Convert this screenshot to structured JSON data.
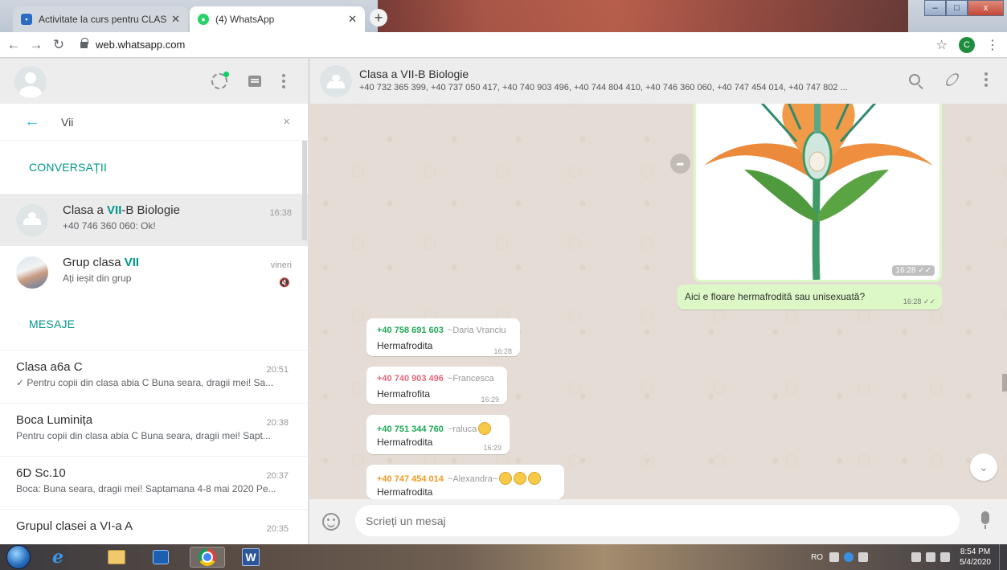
{
  "browser": {
    "tabs": [
      {
        "title": "Activitate la curs pentru CLASA a",
        "close": "✕"
      },
      {
        "title": "(4) WhatsApp",
        "close": "✕"
      }
    ],
    "new_tab": "+",
    "url": "web.whatsapp.com",
    "profile_initial": "C",
    "window_controls": {
      "minimize": "–",
      "maximize": "□",
      "close": "x"
    }
  },
  "sidebar": {
    "search_query": "Vii",
    "clear_icon": "×",
    "sections": {
      "conversations": "CONVERSAȚII",
      "messages": "MESAJE"
    },
    "conversations": [
      {
        "title_pre": "Clasa a ",
        "title_match": "VII",
        "title_post": "-B Biologie",
        "subtitle": "+40 746 360 060: Ok!",
        "time": "16:38",
        "active": true,
        "avatar": "group-avatar"
      },
      {
        "title_pre": "Grup clasa ",
        "title_match": "VII",
        "title_post": "",
        "subtitle": "Ați ieșit din grup",
        "time": "vineri",
        "muted": true,
        "avatar": "photo-avatar"
      }
    ],
    "messages": [
      {
        "title": "Clasa a6a C",
        "time": "20:51",
        "subtitle": "✓ Pentru copii din clasa abia C Buna seara, dragii mei! Sa..."
      },
      {
        "title": "Boca Luminița",
        "time": "20:38",
        "subtitle": "Pentru copii din clasa abia C Buna seara, dragii mei! Sapt..."
      },
      {
        "title": "6D Sc.10",
        "time": "20:37",
        "subtitle": "Boca: Buna seara, dragii mei! Saptamana 4-8 mai 2020 Pe..."
      },
      {
        "title": "Grupul clasei a VI-a A",
        "time": "20:35",
        "subtitle": ""
      }
    ]
  },
  "conversation": {
    "title": "Clasa a VII-B Biologie",
    "members": "+40 732 365 399, +40 737 050 417, +40 740 903 496, +40 744 804 410, +40 746 360 060, +40 747 454 014, +40 747 802 ...",
    "image_message": {
      "time": "16:28 ✓✓",
      "caption": "Aici e floare hermafrodită sau unisexuată?",
      "caption_time": "16:28 ✓✓"
    },
    "incoming": [
      {
        "phone": "+40 758 691 603",
        "alias": "~Daria Vranciu",
        "text": "Hermafrodita",
        "time": "16:28",
        "color": "#1fa855"
      },
      {
        "phone": "+40 740 903 496",
        "alias": "~Francesca",
        "text": "Hermafrofita",
        "time": "16:29",
        "color": "#e5677a"
      },
      {
        "phone": "+40 751 344 760",
        "alias": "~raluca",
        "text": "Hermafrodita",
        "time": "16:29",
        "color": "#1fa855"
      },
      {
        "phone": "+40 747 454 014",
        "alias": "~Alexandra~",
        "text": "Hermafrodita",
        "time": "16:29",
        "color": "#f19a24"
      }
    ],
    "composer_placeholder": "Scrieți un mesaj"
  },
  "taskbar": {
    "lang": "RO",
    "time": "8:54 PM",
    "date": "5/4/2020"
  }
}
